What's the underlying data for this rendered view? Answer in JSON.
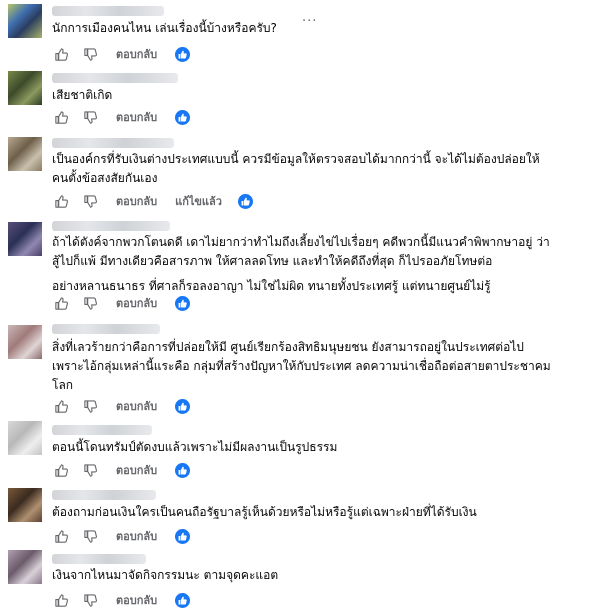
{
  "reply_label": "ตอบกลับ",
  "edited_label": "แก้ไขแล้ว",
  "more_glyph": "...",
  "comments": [
    {
      "lines": [
        "นักการเมืองคนไหน เล่นเรื่องนี้บ้างหรือครับ?"
      ]
    },
    {
      "lines": [
        "เสียชาติเกิด"
      ]
    },
    {
      "lines": [
        "เป็นองค์กรที่รับเงินต่างประเทศแบบนี้ ควรมีข้อมูลให้ตรวจสอบได้มากกว่านี้ จะได้ไม่ต้องปล่อยให้",
        "คนตั้งข้อสงสัยกันเอง"
      ]
    },
    {
      "lines": [
        "ถ้าได้ตังค์จากพวกโตนดดี เดาไม่ยากว่าทำไมถึงเลี้ยงไข่ไปเรื่อยๆ คดีพวกนี้มีแนวคำพิพากษาอยู่ ว่า",
        "สู้ไปก็แพ้ มีทางเดียวคือสารภาพ ให้ศาลลดโทษ และทำให้คดีถึงที่สุด ก็ไปรออภัยโทษต่อ",
        "อย่างหลานธนาธร ที่ศาลก็รอลงอาญา ไม่ใช่ไม่ผิด ทนายทั้งประเทศรู้ แต่ทนายศูนย์ไม่รู้"
      ]
    },
    {
      "lines": [
        "สิ่งที่เลวร้ายกว่าคือการที่ปล่อยให้มี ศูนย์เรียกร้องสิทธิมนุษยชน ยังสามารถอยู่ในประเทศต่อไป",
        "เพราะไอ้กลุ่มเหล่านี้แระคือ กลุ่มที่สร้างปัญหาให้กับประเทศ ลดความน่าเชื่อถือต่อสายตาประชาคม",
        "โลก"
      ]
    },
    {
      "lines": [
        "ตอนนี้โดนทรัมป์ตัดงบแล้วเพราะไม่มีผลงานเป็นรูปธรรม"
      ]
    },
    {
      "lines": [
        "ต้องถามก่อนเงินใครเป็นคนถือรัฐบาลรู้เห็นด้วยหรือไม่หรือรู้แต่เฉพาะฝ่ายที่ได้รับเงิน"
      ]
    },
    {
      "lines": [
        "เงินจากไหนมาจัดกิจกรรมนะ ตามจุดคะแอต"
      ]
    }
  ]
}
